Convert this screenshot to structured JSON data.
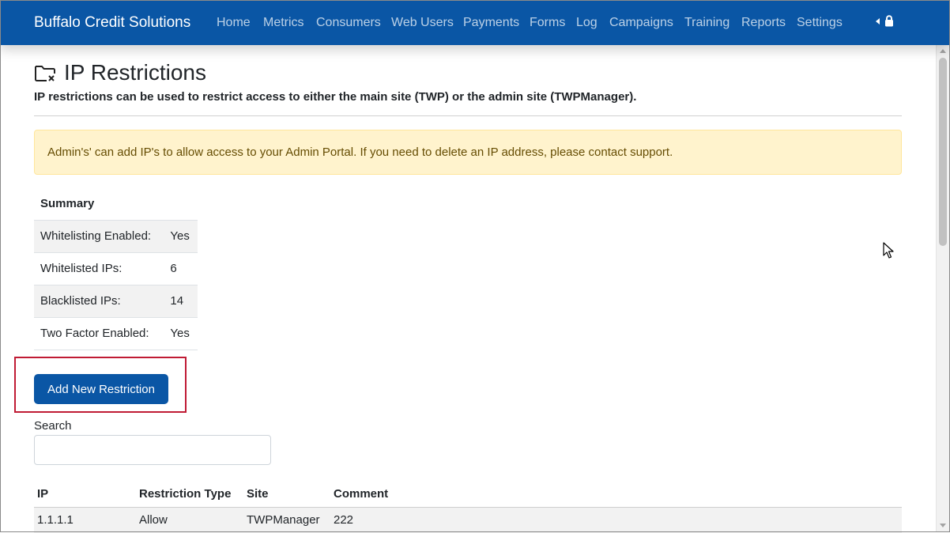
{
  "navbar": {
    "brand": "Buffalo Credit Solutions",
    "items": [
      "Home",
      "Metrics",
      "Consumers",
      "Web Users",
      "Payments",
      "Forms",
      "Log",
      "Campaigns",
      "Training",
      "Reports",
      "Settings"
    ]
  },
  "page": {
    "title": "IP Restrictions",
    "subtitle": "IP restrictions can be used to restrict access to either the main site (TWP) or the admin site (TWPManager)."
  },
  "alert": {
    "text": "Admin's' can add IP's to allow access to your Admin Portal. If you need to delete an IP address, please contact support."
  },
  "summary": {
    "heading": "Summary",
    "rows": [
      {
        "label": "Whitelisting Enabled:",
        "value": "Yes"
      },
      {
        "label": "Whitelisted IPs:",
        "value": "6"
      },
      {
        "label": "Blacklisted IPs:",
        "value": "14"
      },
      {
        "label": "Two Factor Enabled:",
        "value": "Yes"
      }
    ]
  },
  "actions": {
    "add_label": "Add New Restriction"
  },
  "search": {
    "label": "Search",
    "value": ""
  },
  "table": {
    "columns": [
      "IP",
      "Restriction Type",
      "Site",
      "Comment"
    ],
    "rows": [
      {
        "ip": "1.1.1.1",
        "type": "Allow",
        "site": "TWPManager",
        "comment": "222"
      }
    ]
  },
  "colors": {
    "navbar": "#0a56a5",
    "alert_bg": "#fff3cd",
    "alert_text": "#664d03",
    "highlight": "#c01b34"
  }
}
